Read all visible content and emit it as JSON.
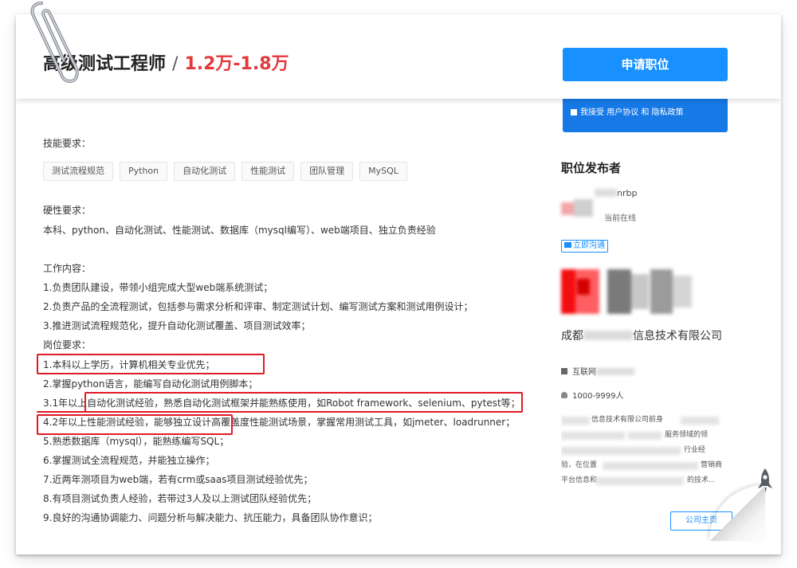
{
  "header": {
    "job_title": "高级测试工程师",
    "separator": "/",
    "salary": "1.2万-1.8万",
    "apply_button": "申请职位"
  },
  "consent": {
    "text": "我接受 用户协议 和 隐私政策"
  },
  "job": {
    "skills_label": "技能要求：",
    "skill_tags": [
      "测试流程规范",
      "Python",
      "自动化测试",
      "性能测试",
      "团队管理",
      "MySQL"
    ],
    "hard_req_label": "硬性要求：",
    "hard_req_text": "本科、python、自动化测试、性能测试、数据库（mysql编写）、web端项目、独立负责经验",
    "work_label": "工作内容：",
    "work_items": [
      "1.负责团队建设，带领小组完成大型web端系统测试；",
      "2.负责产品的全流程测试，包括参与需求分析和评审、制定测试计划、编写测试方案和测试用例设计；",
      "3.推进测试流程规范化，提升自动化测试覆盖、项目测试效率；"
    ],
    "req_label": "岗位要求：",
    "req_items": [
      "1.本科以上学历，计算机相关专业优先；",
      "2.掌握python语言，能编写自动化测试用例脚本；",
      "3.1年以上自动化测试经验，熟悉自动化测试框架并能熟练使用，如Robot framework、selenium、pytest等；",
      "4.2年以上性能测试经验，能够独立设计高覆盖度性能测试场景，掌握常用测试工具，如jmeter、loadrunner；",
      "5.熟悉数据库（mysql），能熟练编写SQL；",
      "6.掌握测试全流程规范，并能独立操作；",
      "7.近两年测项目为web端，若有crm或saas项目测试经验优先；",
      "8.有项目测试负责人经验，若带过3人及以上测试团队经验优先；",
      "9.良好的沟通协调能力、问题分析与解决能力、抗压能力，具备团队协作意识；"
    ]
  },
  "publisher": {
    "section_title": "职位发布者",
    "name_suffix": "nrbp",
    "status": "当前在线",
    "chat_button": "立即沟通"
  },
  "company": {
    "name_prefix": "成都",
    "name_suffix": "信息技术有限公司",
    "industry_prefix": "互联网",
    "size": "1000-9999人",
    "desc_lines": [
      "信息技术有限公司前身",
      "",
      "验，在位置",
      "平台信息和"
    ],
    "desc_right": [
      "",
      "服务领域的领",
      "行业经",
      "营销商"
    ],
    "desc_tail": "的技术...",
    "homepage_button": "公司主页"
  },
  "colors": {
    "accent": "#1890ff",
    "salary": "#e4393c",
    "highlight": "#e01b24"
  }
}
